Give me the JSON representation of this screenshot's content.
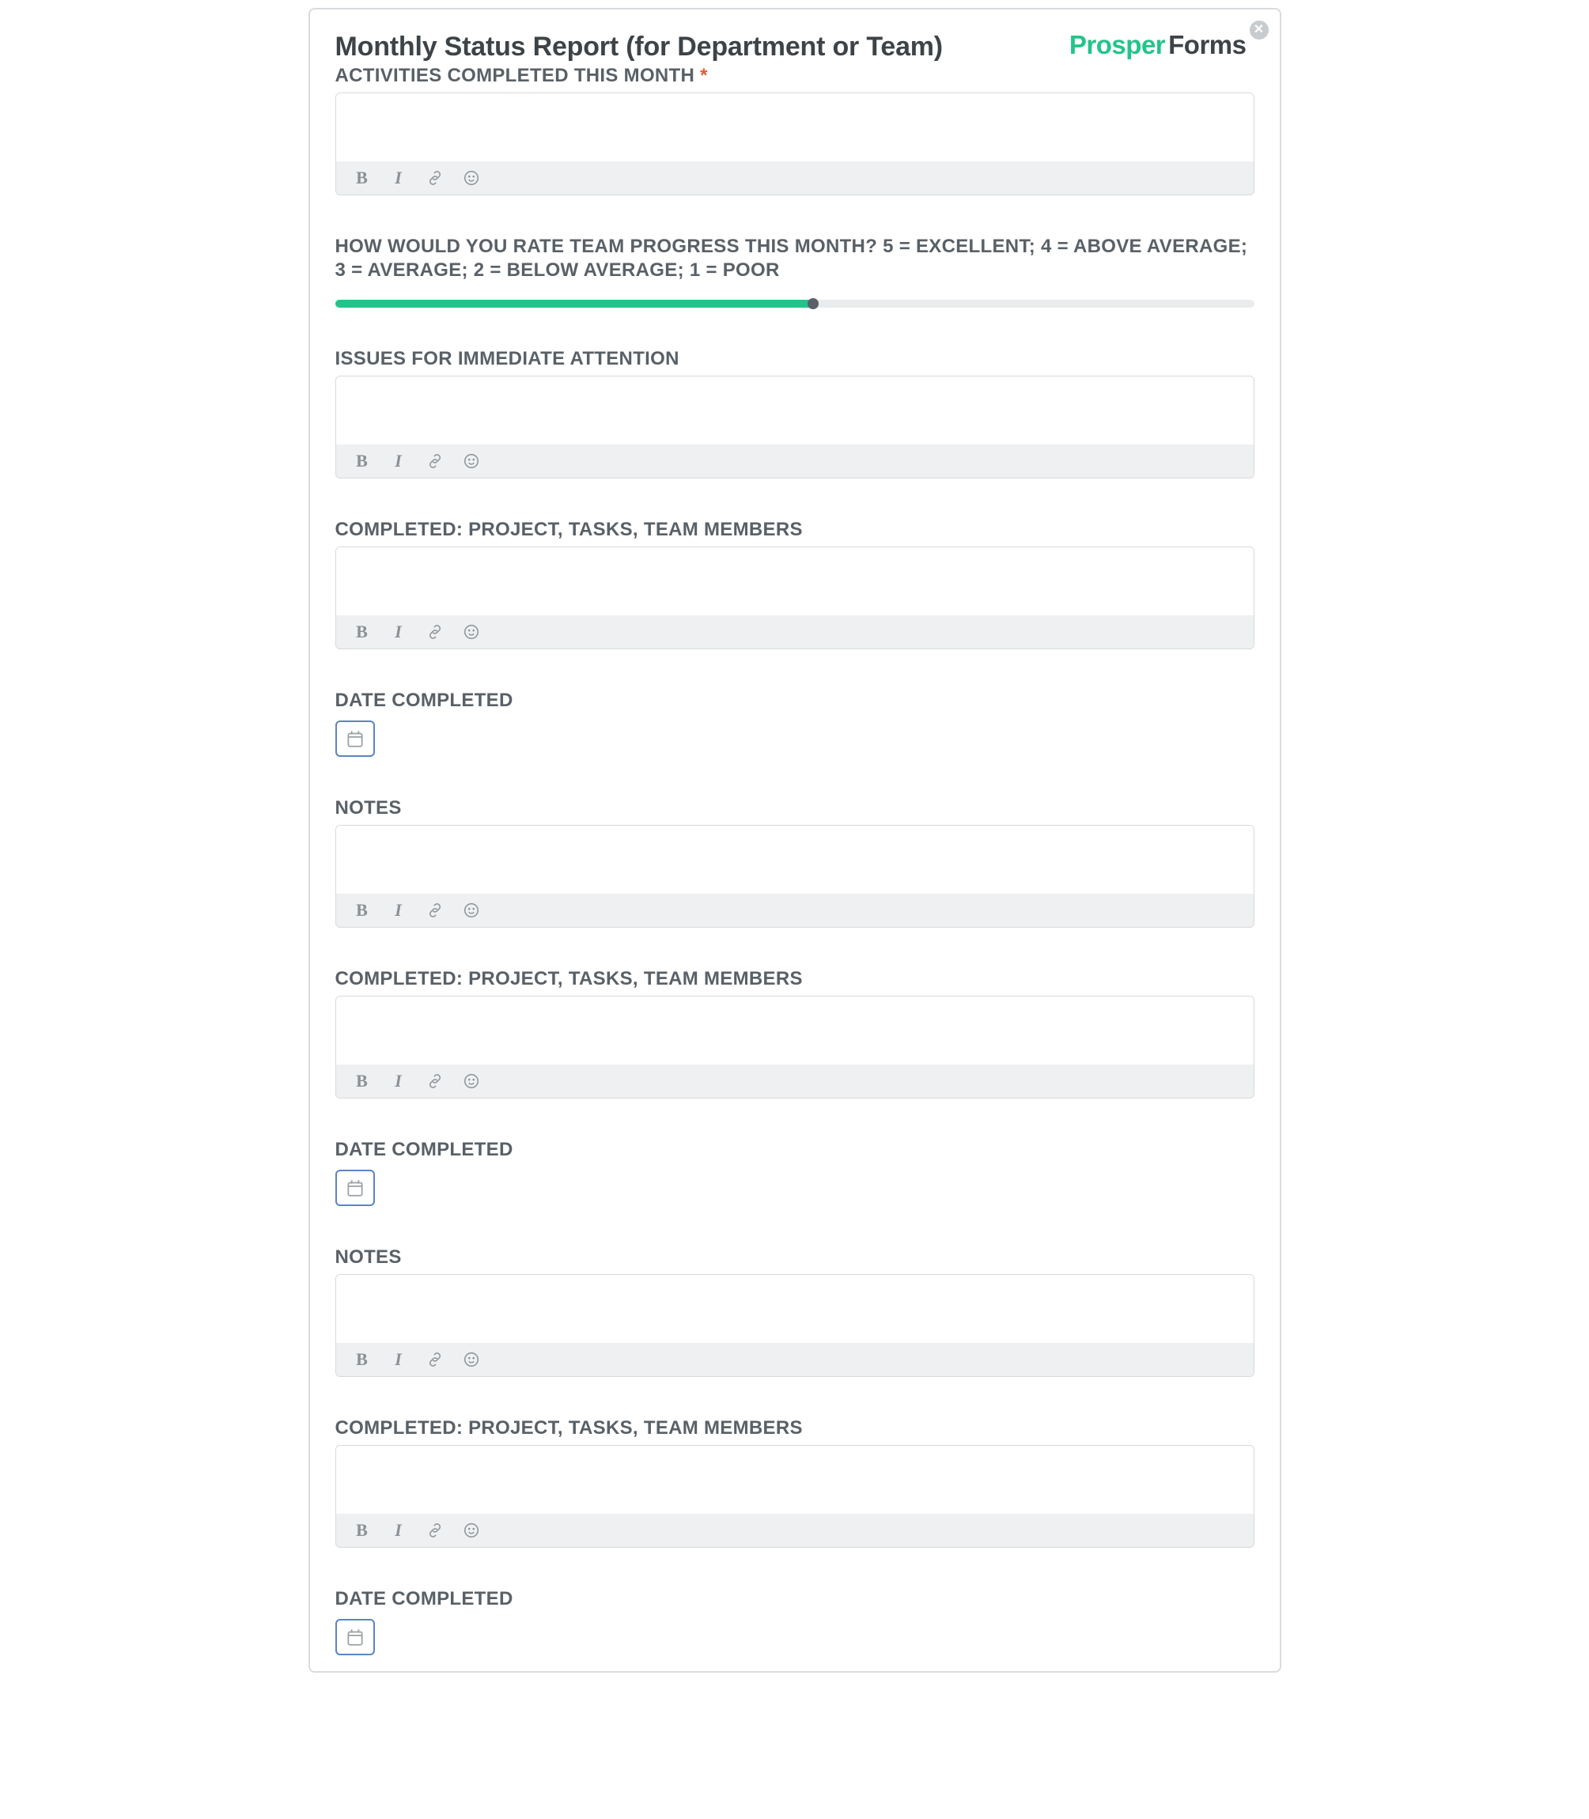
{
  "brand": {
    "part1": "Prosper",
    "part2": "Forms"
  },
  "form_title": "Monthly Status Report (for Department or Team)",
  "required_marker": "*",
  "toolbar": {
    "bold": "B",
    "italic": "I"
  },
  "slider": {
    "percent": 52
  },
  "fields": [
    {
      "key": "activities",
      "label": "ACTIVITIES COMPLETED THIS MONTH",
      "required": true,
      "type": "richtext"
    },
    {
      "key": "rating",
      "label": "HOW WOULD YOU RATE TEAM PROGRESS THIS MONTH? 5 = EXCELLENT; 4 = ABOVE AVERAGE; 3 = AVERAGE; 2 = BELOW AVERAGE; 1 = POOR",
      "required": false,
      "type": "slider"
    },
    {
      "key": "issues",
      "label": "ISSUES FOR IMMEDIATE ATTENTION",
      "required": false,
      "type": "richtext"
    },
    {
      "key": "completed1",
      "label": "COMPLETED: PROJECT, TASKS, TEAM MEMBERS",
      "required": false,
      "type": "richtext"
    },
    {
      "key": "date1",
      "label": "DATE COMPLETED",
      "required": false,
      "type": "date"
    },
    {
      "key": "notes1",
      "label": "NOTES",
      "required": false,
      "type": "richtext"
    },
    {
      "key": "completed2",
      "label": "COMPLETED: PROJECT, TASKS, TEAM MEMBERS",
      "required": false,
      "type": "richtext"
    },
    {
      "key": "date2",
      "label": "DATE COMPLETED",
      "required": false,
      "type": "date"
    },
    {
      "key": "notes2",
      "label": "NOTES",
      "required": false,
      "type": "richtext"
    },
    {
      "key": "completed3",
      "label": "COMPLETED: PROJECT, TASKS, TEAM MEMBERS",
      "required": false,
      "type": "richtext"
    },
    {
      "key": "date3",
      "label": "DATE COMPLETED",
      "required": false,
      "type": "date"
    }
  ]
}
